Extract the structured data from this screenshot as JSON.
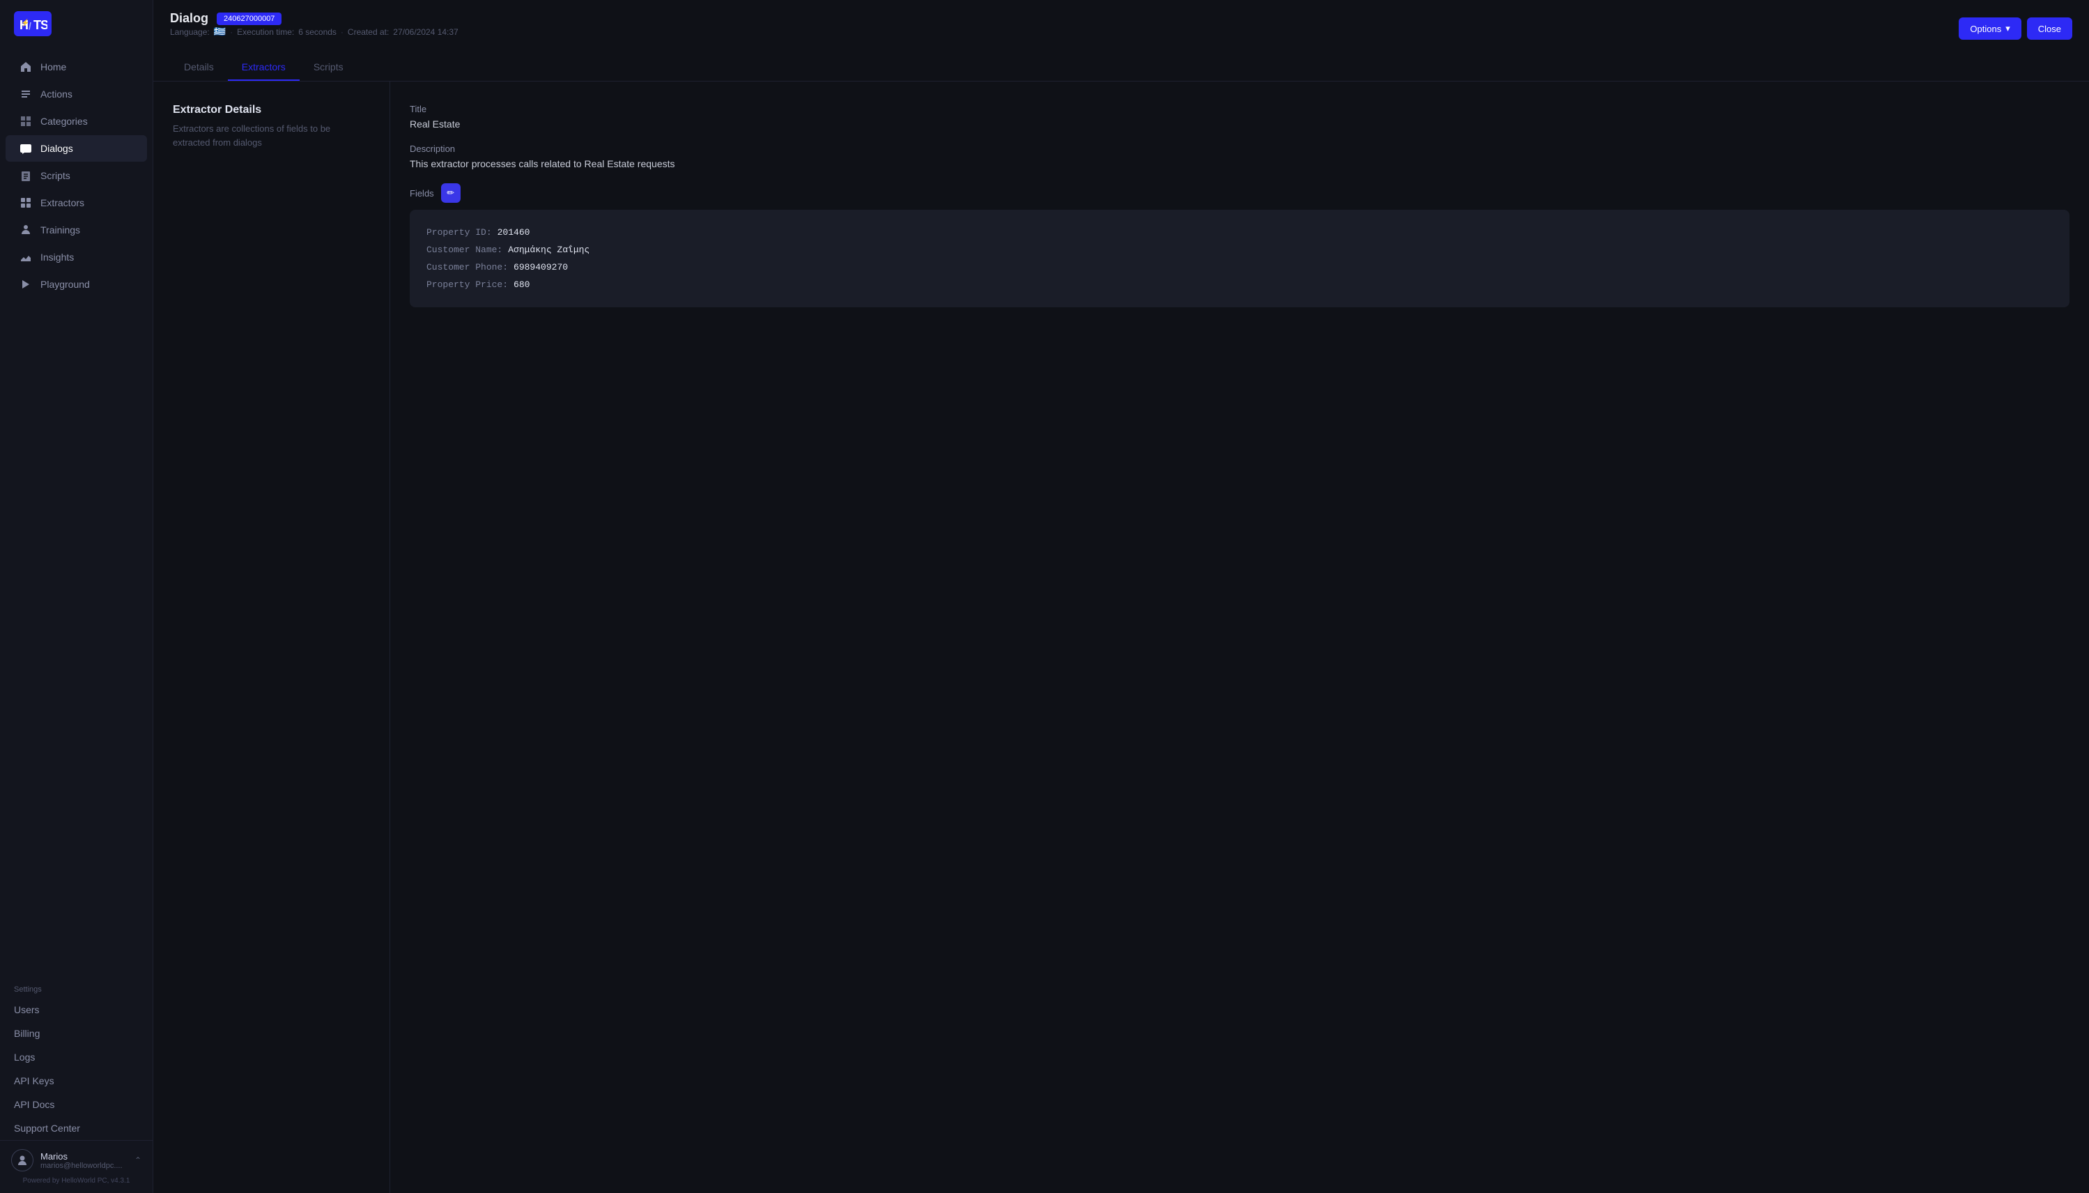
{
  "sidebar": {
    "logo": "H/TS",
    "nav_items": [
      {
        "id": "home",
        "label": "Home",
        "icon": "home-icon",
        "active": false
      },
      {
        "id": "actions",
        "label": "Actions",
        "icon": "actions-icon",
        "active": false
      },
      {
        "id": "categories",
        "label": "Categories",
        "icon": "categories-icon",
        "active": false
      },
      {
        "id": "dialogs",
        "label": "Dialogs",
        "icon": "dialogs-icon",
        "active": true
      },
      {
        "id": "scripts",
        "label": "Scripts",
        "icon": "scripts-icon",
        "active": false
      },
      {
        "id": "extractors",
        "label": "Extractors",
        "icon": "extractors-icon",
        "active": false
      },
      {
        "id": "trainings",
        "label": "Trainings",
        "icon": "trainings-icon",
        "active": false
      },
      {
        "id": "insights",
        "label": "Insights",
        "icon": "insights-icon",
        "active": false
      },
      {
        "id": "playground",
        "label": "Playground",
        "icon": "playground-icon",
        "active": false
      }
    ],
    "settings_label": "Settings",
    "settings_items": [
      "Users",
      "Billing",
      "Logs",
      "API Keys",
      "API Docs",
      "Support Center"
    ],
    "user": {
      "name": "Marios",
      "email": "marios@helloworldpc....",
      "chevron": "⌃"
    },
    "powered_by": "Powered by HelloWorld PC, v4.3.1"
  },
  "header": {
    "title": "Dialog",
    "dialog_id": "240627000007",
    "language_label": "Language:",
    "flag": "🇬🇷",
    "execution_label": "Execution time:",
    "execution_value": "6 seconds",
    "created_label": "Created at:",
    "created_value": "27/06/2024 14:37",
    "btn_options": "Options",
    "btn_close": "Close",
    "tabs": [
      "Details",
      "Extractors",
      "Scripts"
    ],
    "active_tab": "Extractors"
  },
  "left_panel": {
    "title": "Extractor Details",
    "description": "Extractors are collections of fields to be extracted from dialogs"
  },
  "right_panel": {
    "title_label": "Title",
    "title_value": "Real Estate",
    "description_label": "Description",
    "description_value": "This extractor processes calls related to Real Estate requests",
    "fields_label": "Fields",
    "edit_icon": "✏",
    "fields": [
      {
        "key": "Property ID:",
        "value": "201460"
      },
      {
        "key": "Customer Name:",
        "value": "Ασημάκης Ζαΐμης"
      },
      {
        "key": "Customer Phone:",
        "value": "6989409270"
      },
      {
        "key": "Property Price:",
        "value": "680"
      }
    ]
  }
}
